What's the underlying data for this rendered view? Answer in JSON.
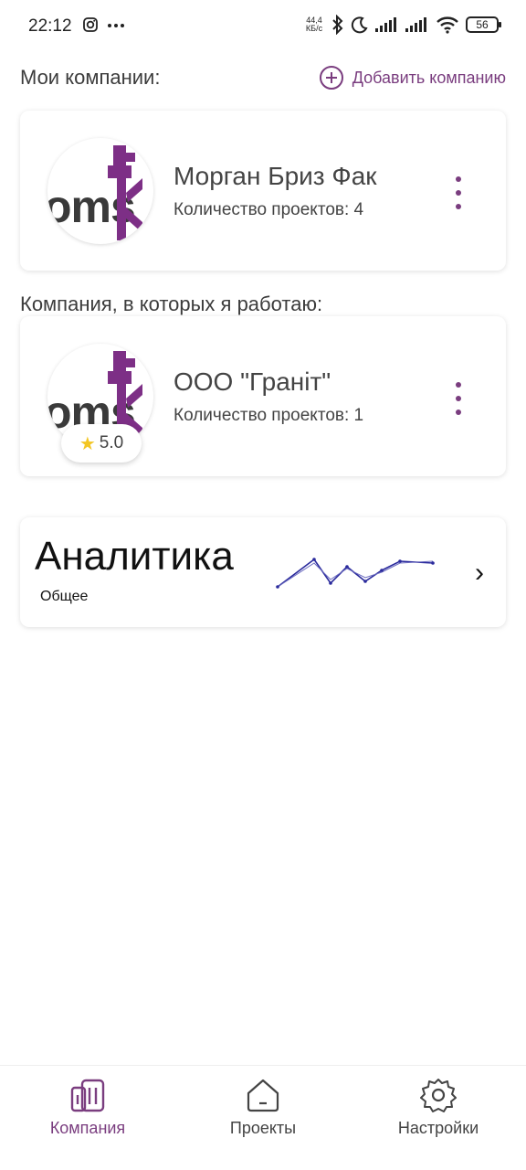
{
  "status_bar": {
    "time": "22:12",
    "net_speed_value": "44,4",
    "net_speed_unit": "КБ/с",
    "battery": "56",
    "icons": [
      "instagram-icon",
      "more-icon",
      "bluetooth-icon",
      "moon-icon",
      "signal-icon",
      "signal-icon",
      "wifi-icon",
      "battery-icon"
    ]
  },
  "header": {
    "my_companies": "Мои компании:",
    "add_company": "Добавить компанию"
  },
  "my_companies": [
    {
      "name": "Морган Бриз Фак",
      "projects_label": "Количество проектов: 4"
    }
  ],
  "work_section": {
    "title": "Компания, в которых я работаю:"
  },
  "work_companies": [
    {
      "name": "ООО \"Граніт\"",
      "projects_label": "Количество проектов: 1",
      "rating": "5.0"
    }
  ],
  "analytics": {
    "title": "Аналитика",
    "subtitle": "Общее",
    "accent": "#2a2a9c"
  },
  "bottom_nav": [
    {
      "label": "Компания",
      "icon": "buildings-icon",
      "active": true
    },
    {
      "label": "Проекты",
      "icon": "home-icon",
      "active": false
    },
    {
      "label": "Настройки",
      "icon": "gear-icon",
      "active": false
    }
  ],
  "colors": {
    "accent": "#7a3d7f",
    "text": "#444444"
  }
}
